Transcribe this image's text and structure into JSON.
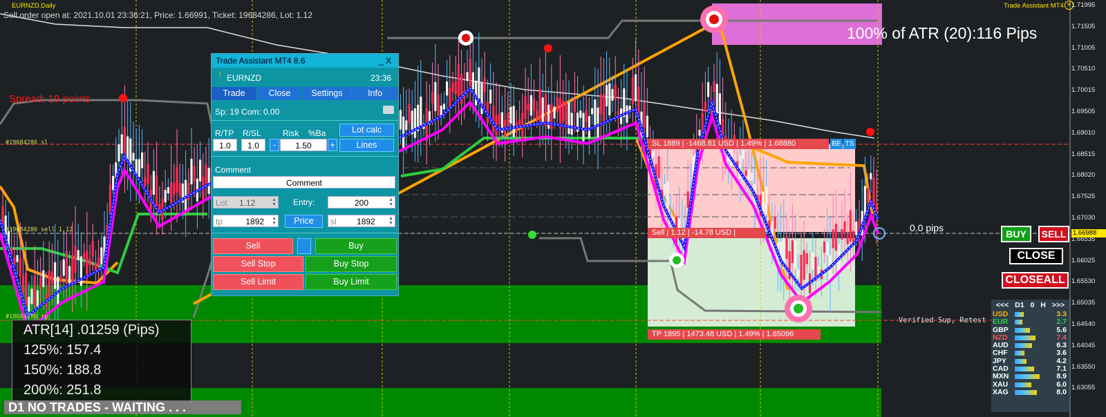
{
  "window": {
    "symbol": "EURNZD,Daily",
    "order_info": "Sell order open at: 2021.10.01 23:36:21, Price: 1.66991, Ticket: 19684286, Lot: 1.12",
    "indicator_name": "Trade Assistant MT4",
    "spread_text": "Spread: 19 points",
    "atr_pct_text": "100% of ATR (20):116 Pips",
    "pips_label": "0.0 pips",
    "verified_sup": "Verified Sup, Retest",
    "sl_line_label": "#19684286 sl",
    "sell_line_label": "#19684286 sell 1.12",
    "tp_line_label": "#19684286 tp"
  },
  "price_axis": {
    "ticks": [
      "1.71995",
      "1.71505",
      "1.71005",
      "1.70510",
      "1.70015",
      "1.69505",
      "1.69010",
      "1.68515",
      "1.68020",
      "1.67525",
      "1.67030",
      "1.66535",
      "1.66025",
      "1.65530",
      "1.65035",
      "1.64540",
      "1.64045",
      "1.63550",
      "1.63055"
    ],
    "current": "1.66988"
  },
  "atr_box": {
    "line1": "ATR[14] .01259  (Pips)",
    "line2": "125%: 157.4",
    "line3": "150%: 188.8",
    "line4": "200%: 251.8"
  },
  "status": "D1  NO TRADES - WAITING . . .",
  "trade_levels": {
    "sl": "SL 1889 | -1468.81 USD | 1.49% | 1.68880",
    "sl_badges": [
      "BE",
      "TS"
    ],
    "entry": "Sell | 1.12 | -14.78 USD |",
    "tp": "TP 1895 | 1473.48 USD | 1.49% | 1.65096"
  },
  "panel": {
    "title": "Trade Assistant MT4 8.6",
    "title_buttons": "_   X",
    "symbol": "EURNZD",
    "time": "23:36",
    "tabs": [
      "Trade",
      "Close",
      "Settings",
      "Info"
    ],
    "spread_comm": "Sp: 19   Com: 0.00",
    "labels": {
      "rtp": "R/TP",
      "rsl": "R/SL",
      "risk": "Risk",
      "pct": "%Ba"
    },
    "rtp_value": "1.0",
    "rsl_value": "1.0",
    "risk_value": "1.50",
    "minus": "-",
    "plus": "+",
    "lot_calc": "Lot calc",
    "lines": "Lines",
    "comment_label": "Comment",
    "comment_value": "Comment",
    "lot_label": "Lot",
    "lot_value": "1.12",
    "entry_label": "Entry:",
    "entry_value": "200",
    "tp_label": "tp",
    "tp_value": "1892",
    "price_button": "Price",
    "sl_label": "sl",
    "sl_value": "1892",
    "sell": "Sell",
    "buy": "Buy",
    "sell_stop": "Sell Stop",
    "buy_stop": "Buy Stop",
    "sell_limit": "Sell Limit",
    "buy_limit": "Buy Limit"
  },
  "right_buttons": {
    "buy": "BUY",
    "sell": "SELL",
    "close": "CLOSE",
    "closeall": "CLOSEALL"
  },
  "meter": {
    "header": [
      "<<<",
      "D1",
      "0",
      "H",
      ">>>"
    ],
    "rows": [
      {
        "cur": "USD",
        "val": "3.3",
        "color": "#ffb400",
        "level": 0.33
      },
      {
        "cur": "EUR",
        "val": "2.7",
        "color": "#30d040",
        "level": 0.27
      },
      {
        "cur": "GBP",
        "val": "5.6",
        "color": "#ffffff",
        "level": 0.56
      },
      {
        "cur": "NZD",
        "val": "7.4",
        "color": "#ff5050",
        "level": 0.74
      },
      {
        "cur": "AUD",
        "val": "6.3",
        "color": "#ffffff",
        "level": 0.63
      },
      {
        "cur": "CHF",
        "val": "3.6",
        "color": "#ffffff",
        "level": 0.36
      },
      {
        "cur": "JPY",
        "val": "4.2",
        "color": "#ffffff",
        "level": 0.42
      },
      {
        "cur": "CAD",
        "val": "7.1",
        "color": "#ffffff",
        "level": 0.71
      },
      {
        "cur": "MXN",
        "val": "8.9",
        "color": "#ffffff",
        "level": 0.89
      },
      {
        "cur": "XAU",
        "val": "6.0",
        "color": "#ffffff",
        "level": 0.6
      },
      {
        "cur": "XAG",
        "val": "8.0",
        "color": "#ffffff",
        "level": 0.8
      }
    ]
  },
  "colors": {
    "background": "#1d2123",
    "bull": "#ffffff",
    "bear": "#ff1a4a",
    "support": "#008800",
    "ma_blue": "#1a1aff",
    "ma_magenta": "#ff00ff",
    "trend": "#ffa500"
  }
}
